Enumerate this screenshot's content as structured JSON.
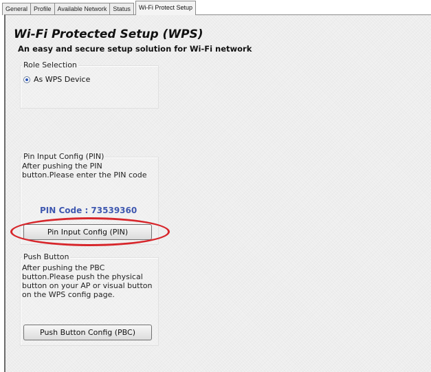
{
  "tabs": [
    {
      "label": "General",
      "active": false
    },
    {
      "label": "Profile",
      "active": false
    },
    {
      "label": "Available Network",
      "active": false
    },
    {
      "label": "Status",
      "active": false
    },
    {
      "label": "Wi-Fi Protect Setup",
      "active": true
    }
  ],
  "header": {
    "title": "Wi-Fi Protected Setup (WPS)",
    "subtitle": "An easy and secure setup solution for Wi-Fi network"
  },
  "role_selection": {
    "legend": "Role Selection",
    "option_label": "As WPS Device",
    "selected": true
  },
  "pin_group": {
    "legend": "Pin Input Config (PIN)",
    "line1": "After pushing the PIN",
    "line2": "button.Please enter the PIN code",
    "pin_code": "PIN Code : 73539360",
    "button_label": "Pin Input Config (PIN)"
  },
  "pbc_group": {
    "legend": "Push Button",
    "line1": "After pushing the PBC",
    "line2": "button.Please push the physical",
    "line3": "button on your AP or visual button",
    "line4": "on the WPS config page.",
    "button_label": "Push Button Config (PBC)"
  },
  "colors": {
    "highlight_ellipse": "#d7262b",
    "pin_code_text": "#3f58b0"
  }
}
